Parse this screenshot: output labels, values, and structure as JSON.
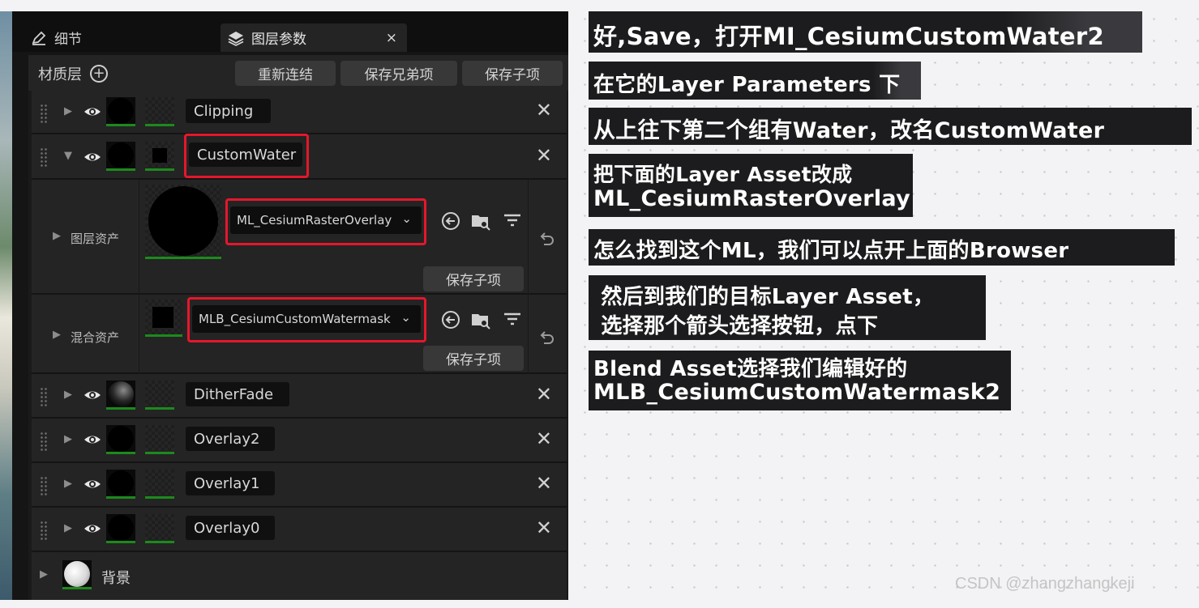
{
  "tabs": {
    "details": "细节",
    "layer_params": "图层参数",
    "close": "×"
  },
  "toolbar": {
    "title": "材质层",
    "add": "+",
    "relink": "重新连结",
    "save_sibling": "保存兄弟项",
    "save_child": "保存子项"
  },
  "layers": [
    {
      "name": "Clipping",
      "expanded": false
    },
    {
      "name": "CustomWater",
      "expanded": true
    },
    {
      "name": "DitherFade",
      "expanded": false
    },
    {
      "name": "Overlay2",
      "expanded": false
    },
    {
      "name": "Overlay1",
      "expanded": false
    },
    {
      "name": "Overlay0",
      "expanded": false
    }
  ],
  "layer_asset": {
    "label": "图层资产",
    "value": "ML_CesiumRasterOverlay",
    "save_child": "保存子项"
  },
  "blend_asset": {
    "label": "混合资产",
    "value": "MLB_CesiumCustomWatermask",
    "save_child": "保存子项"
  },
  "background_layer": "背景",
  "icons": {
    "expand": "triangle-right-icon",
    "collapse": "triangle-down-icon",
    "visibility": "eye-icon",
    "remove": "close-icon",
    "use_selected": "arrow-left-circle-icon",
    "browse": "folder-search-icon",
    "filter": "filter-icon",
    "reset": "undo-arrow-icon"
  },
  "highlight_color": "#e5172b",
  "captions": [
    "好,Save，打开MI_CesiumCustomWater2",
    "在它的Layer Parameters 下",
    "从上往下第二个组有Water，改名CustomWater",
    "把下面的Layer Asset改成",
    "ML_CesiumRasterOverlay",
    "怎么找到这个ML，我们可以点开上面的Browser",
    " 然后到我们的目标Layer Asset，",
    " 选择那个箭头选择按钮，点下",
    "Blend Asset选择我们编辑好的",
    "MLB_CesiumCustomWatermask2"
  ],
  "watermark": "CSDN @zhangzhangkeji"
}
